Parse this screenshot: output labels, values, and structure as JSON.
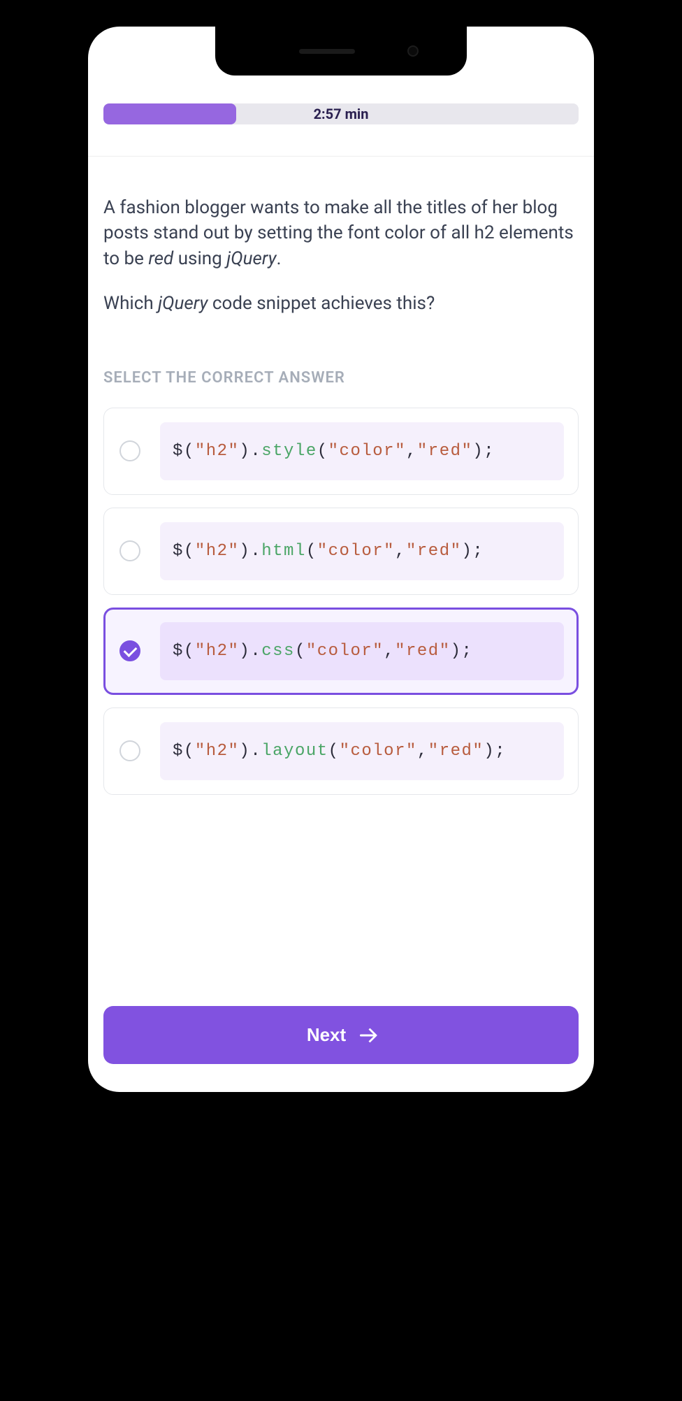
{
  "timer": "2:57 min",
  "question": {
    "line1_pre": "A fashion blogger wants to make all the titles of her blog posts stand out by setting the font color of all h2 elements to be ",
    "line1_em1": "red",
    "line1_mid": " using ",
    "line1_em2": "jQuery",
    "line1_post": ".",
    "line2_pre": "Which ",
    "line2_em": "jQuery",
    "line2_post": " code snippet achieves this?"
  },
  "select_label": "SELECT THE CORRECT ANSWER",
  "answers": [
    {
      "prefix": "$(",
      "str1": "\"h2\"",
      "mid": ").",
      "fn": "style",
      "open": "(",
      "str2": "\"color\"",
      "comma": ",",
      "str3": "\"red\"",
      "close": ");",
      "selected": false
    },
    {
      "prefix": "$(",
      "str1": "\"h2\"",
      "mid": ").",
      "fn": "html",
      "open": "(",
      "str2": "\"color\"",
      "comma": ",",
      "str3": "\"red\"",
      "close": ");",
      "selected": false
    },
    {
      "prefix": "$(",
      "str1": "\"h2\"",
      "mid": ").",
      "fn": "css",
      "open": "(",
      "str2": "\"color\"",
      "comma": ",",
      "str3": "\"red\"",
      "close": ");",
      "selected": true
    },
    {
      "prefix": "$(",
      "str1": "\"h2\"",
      "mid": ").",
      "fn": "layout",
      "open": "(",
      "str2": "\"color\"",
      "comma": ",",
      "str3": "\"red\"",
      "close": ");",
      "selected": false
    }
  ],
  "next_label": "Next"
}
